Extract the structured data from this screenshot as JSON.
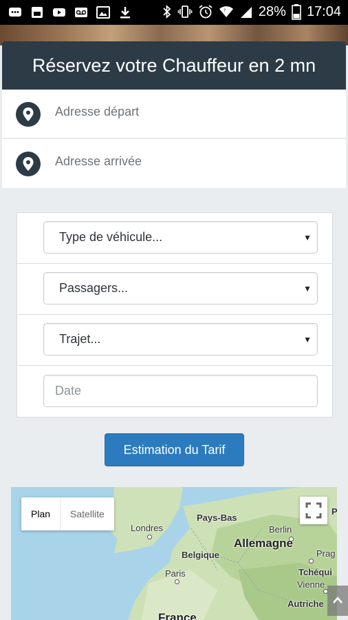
{
  "status_bar": {
    "battery": "28%",
    "time": "17:04",
    "left_icons": [
      "message-icon",
      "image-icon",
      "youtube-icon",
      "voicemail-icon",
      "gallery-icon",
      "download-icon"
    ],
    "right_icons": [
      "bluetooth-icon",
      "vibrate-icon",
      "alarm-icon",
      "wifi-icon",
      "signal-icon",
      "battery-icon"
    ]
  },
  "header": {
    "title": "Réservez votre Chauffeur en 2 mn"
  },
  "addresses": {
    "departure_placeholder": "Adresse départ",
    "arrival_placeholder": "Adresse arrivée"
  },
  "form": {
    "vehicle_type": "Type de véhicule...",
    "passengers": "Passagers...",
    "trip": "Trajet...",
    "date_placeholder": "Date"
  },
  "estimate_button": "Estimation du Tarif",
  "map": {
    "type_plan": "Plan",
    "type_satellite": "Satellite",
    "labels": {
      "pays_bas": "Pays-Bas",
      "londres": "Londres",
      "berlin": "Berlin",
      "allemagne": "Allemagne",
      "belgique": "Belgique",
      "prag": "Prag",
      "paris": "Paris",
      "tcheque": "Tchéqui",
      "vienne": "Vienne",
      "autriche": "Autriche",
      "france": "France",
      "edge_p": "P"
    }
  },
  "colors": {
    "header_bg": "#2c3b46",
    "button_bg": "#2c7bbf",
    "page_bg": "#e9edf0"
  }
}
